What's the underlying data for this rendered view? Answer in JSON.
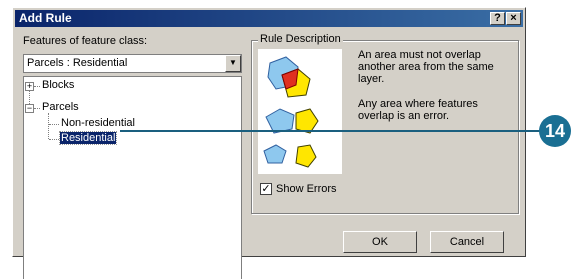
{
  "dialog": {
    "title": "Add Rule",
    "help_button": "?",
    "close_button": "×"
  },
  "features": {
    "label": "Features of feature class:",
    "selected": "Parcels : Residential",
    "tree": {
      "blocks": "Blocks",
      "parcels": "Parcels",
      "non_residential": "Non-residential",
      "residential": "Residential"
    }
  },
  "rule_description": {
    "title": "Rule Description",
    "text1": "An area must not overlap another area from the same layer.",
    "text2": "Any area where features overlap is an error."
  },
  "show_errors": {
    "label": "Show Errors",
    "checked": true
  },
  "buttons": {
    "ok": "OK",
    "cancel": "Cancel"
  },
  "callout": {
    "number": "14"
  },
  "colors": {
    "titlebar": "#0a246a",
    "selection": "#0a246a",
    "callout": "#1a6f93",
    "shape_blue": "#8ec8ee",
    "shape_yellow": "#ffe600",
    "overlap_red": "#e03020"
  }
}
